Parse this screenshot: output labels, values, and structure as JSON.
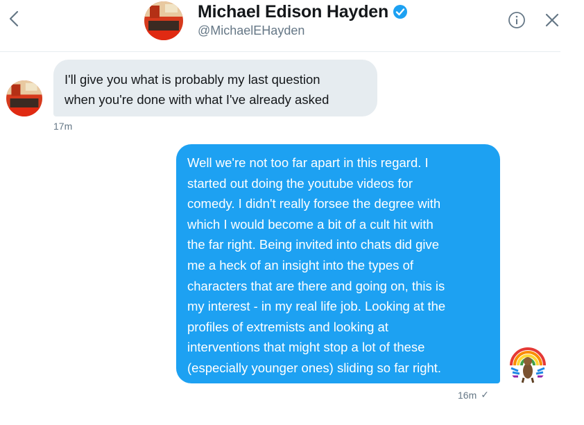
{
  "header": {
    "name": "Michael Edison Hayden",
    "handle": "@MichaelEHayden",
    "icons": {
      "back": "chevron-left-icon",
      "verified": "verified-badge-icon",
      "info": "info-icon",
      "close": "close-icon"
    }
  },
  "colors": {
    "accent": "#1da1f2",
    "incoming_bubble": "#e6ecf0",
    "secondary_text": "#657786",
    "primary_text": "#14171a"
  },
  "messages": [
    {
      "direction": "incoming",
      "lines": [
        "I'll give you what is probably my last question",
        "when you're done with what I've already asked"
      ],
      "timestamp": "17m"
    },
    {
      "direction": "outgoing",
      "lines": [
        "Well we're not too far apart in this regard. I",
        "started out doing the youtube videos for",
        "comedy. I didn't really forsee the degree with",
        "which I would become a bit of a cult hit with",
        "the far right. Being invited into chats did give",
        "me a heck of an insight into the types of",
        "characters that are there and going on, this is",
        "my interest - in my real life job. Looking at the",
        "profiles of extremists and looking at",
        "interventions that might stop a lot of these",
        "(especially younger ones) sliding so far right."
      ],
      "timestamp": "16m",
      "status_icon": "✓"
    }
  ]
}
